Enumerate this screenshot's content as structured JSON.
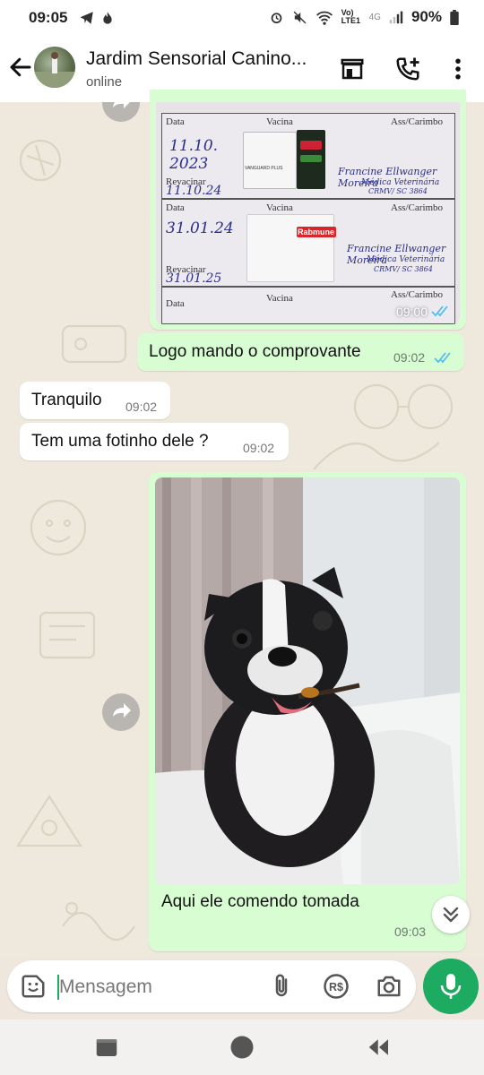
{
  "status_bar": {
    "time": "09:05",
    "network": "Vo) LTE1",
    "signal_gen": "4G",
    "battery": "90%"
  },
  "header": {
    "title": "Jardim Sensorial Canino...",
    "status": "online",
    "icons": [
      "back-arrow-icon",
      "storefront-icon",
      "add-call-icon",
      "more-vert-icon"
    ]
  },
  "vaccine_card": {
    "time": "09:00",
    "rows": [
      {
        "date_label": "Data",
        "vaccine_label": "Vacina",
        "stamp_label": "Ass/Carimbo",
        "date_value": "11.10.\n2023",
        "revaccinate_label": "Revacinar",
        "revaccinate_value": "11.10.24",
        "vaccine_name": "VANGUARD PLUS"
      },
      {
        "date_label": "Data",
        "vaccine_label": "Vacina",
        "stamp_label": "Ass/Carimbo",
        "date_value": "31.01.24",
        "revaccinate_label": "Revacinar",
        "revaccinate_value": "31.01.25",
        "vaccine_name": "Rabmune"
      },
      {
        "date_label": "Data",
        "vaccine_label": "Vacina",
        "stamp_label": "Ass/Carimbo"
      }
    ],
    "signature": "Francine Ellwanger Moreira",
    "signature_title": "Médica Veterinária",
    "crmv": "CRMV/ SC 3864"
  },
  "messages": [
    {
      "dir": "out",
      "text": "Logo mando o comprovante",
      "time": "09:02",
      "read": true
    },
    {
      "dir": "in",
      "text": "Tranquilo",
      "time": "09:02"
    },
    {
      "dir": "in",
      "text": "Tem uma fotinho dele ?",
      "time": "09:02"
    },
    {
      "dir": "out",
      "caption": "Aqui ele comendo tomada",
      "time": "09:03",
      "has_image": true
    }
  ],
  "composer": {
    "placeholder": "Mensagem",
    "icons": [
      "sticker-icon",
      "attach-icon",
      "payment-icon",
      "camera-icon",
      "mic-icon"
    ]
  },
  "colors": {
    "outgoing_bubble": "#d9fdd3",
    "incoming_bubble": "#ffffff",
    "accent_green": "#1daa61",
    "read_ticks": "#53bdeb",
    "wallpaper": "#efe9dd"
  }
}
